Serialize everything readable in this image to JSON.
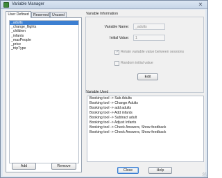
{
  "window": {
    "title": "Variable Manager"
  },
  "tabs": [
    "User Defined",
    "Reserved",
    "Unused"
  ],
  "variables": [
    "_adults",
    "_change_flights",
    "_children",
    "_infants",
    "_maxPeople",
    "_price",
    "_tripType"
  ],
  "left_buttons": {
    "add": "Add",
    "remove": "Remove"
  },
  "info": {
    "section_label": "Variable Information",
    "name_label": "Variable Name:",
    "name_value": "_adults",
    "initial_label": "Initial Value:",
    "initial_value": "1",
    "retain_label": "Retain variable value between sessions",
    "retain_checked": true,
    "random_label": "Random initial value",
    "random_checked": false,
    "edit_label": "Edit"
  },
  "used": {
    "section_label": "Variable Used",
    "items": [
      "Booking tool -> Sub Adults",
      "Booking tool -> Change Adults",
      "Booking tool -> add adults",
      "Booking tool -> Add infants",
      "Booking tool -> Subtract adult",
      "Booking tool -> Adjust Infants",
      "Booking tool -> Check Answers, Show feedback",
      "Booking tool -> Check Answers, Show feedback"
    ]
  },
  "footer": {
    "close": "Close",
    "help": "Help"
  },
  "colors": {
    "selection": "#3c7fd1",
    "titlebar": "#c7d6e8"
  },
  "icons": {
    "app": "app-icon",
    "close": "close-icon"
  }
}
